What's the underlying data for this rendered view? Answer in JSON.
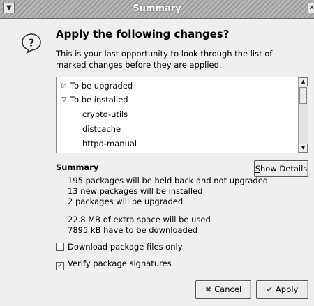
{
  "window": {
    "title": "Summary",
    "menu_icon": "chevron-down-icon",
    "close_icon": "close-icon"
  },
  "dialog_icon": "question-icon",
  "heading": "Apply the following changes?",
  "description_lines": [
    "This is your last opportunity to look through the list of",
    "marked changes before they are applied."
  ],
  "tree": {
    "groups": [
      {
        "label": "To be upgraded",
        "expanded": false
      },
      {
        "label": "To be installed",
        "expanded": true
      }
    ],
    "items": [
      "crypto-utils",
      "distcache",
      "httpd-manual"
    ]
  },
  "summary": {
    "title": "Summary",
    "show_details_prefix": "S",
    "show_details_rest": "how Details",
    "lines": [
      "195 packages will be held back and not upgraded",
      "13 new packages will be installed",
      "2 packages will be upgraded"
    ],
    "space_lines": [
      "22.8 MB of extra space will be used",
      "7895 kB have to be downloaded"
    ]
  },
  "options": {
    "download_only": {
      "label": "Download package files only",
      "checked": false
    },
    "verify_signatures": {
      "label": "Verify package signatures",
      "checked": true
    }
  },
  "buttons": {
    "cancel_prefix": "C",
    "cancel_rest": "ancel",
    "apply_prefix": "A",
    "apply_rest": "pply"
  },
  "colors": {
    "dialog_bg": "#efefef",
    "titlebar_stripe_dark": "#9b9b9b",
    "titlebar_stripe_light": "#b6b6b6"
  }
}
